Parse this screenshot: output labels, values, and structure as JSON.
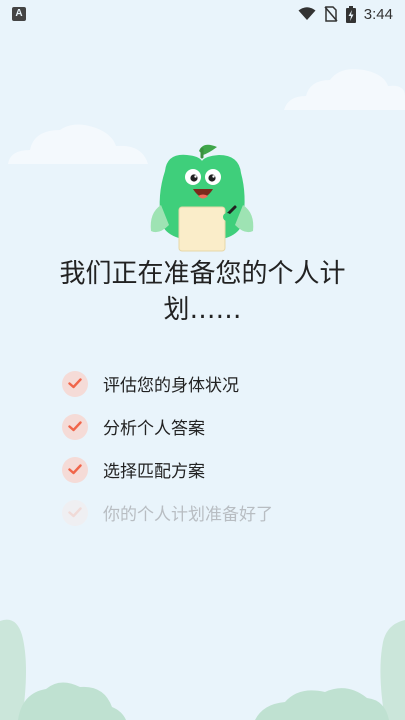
{
  "status_bar": {
    "left_icon": "A",
    "time": "3:44",
    "icons": [
      "notification-a-icon",
      "wifi-icon",
      "no-sim-icon",
      "battery-charging-icon"
    ]
  },
  "main": {
    "mascot_icon": "green-apple-mascot-holding-paper",
    "title": "我们正在准备您的个人计划……"
  },
  "steps": [
    {
      "label": "评估您的身体状况",
      "done": true
    },
    {
      "label": "分析个人答案",
      "done": true
    },
    {
      "label": "选择匹配方案",
      "done": true
    },
    {
      "label": "你的个人计划准备好了",
      "done": false
    }
  ],
  "colors": {
    "background": "#e9f4fb",
    "check": "#f0654a",
    "check_bg": "#f5dbd7",
    "mascot_green": "#3fcf7b",
    "pending_text": "#b8bdc2"
  }
}
